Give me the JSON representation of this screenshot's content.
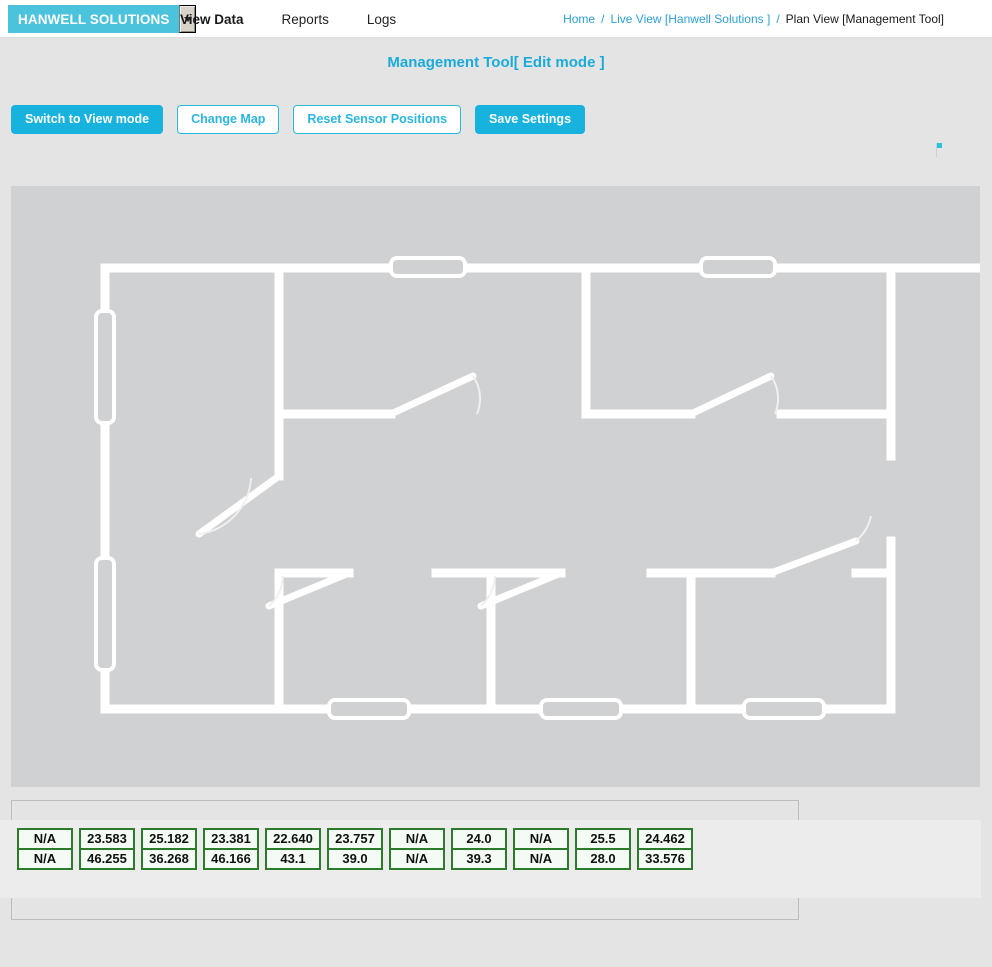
{
  "navbar": {
    "brand": "HANWELL SOLUTIONS",
    "brand_caret_icon": "chevron-down-icon",
    "links": [
      {
        "label": "View Data",
        "active": true
      },
      {
        "label": "Reports",
        "active": false
      },
      {
        "label": "Logs",
        "active": false
      }
    ]
  },
  "breadcrumb": {
    "home": "Home",
    "sep": "/",
    "live_view": "Live View [Hanwell Solutions ]",
    "current": "Plan View [Management Tool]"
  },
  "page": {
    "title": "Management Tool[ Edit mode ]",
    "title_color": "#1aabda"
  },
  "toolbar": {
    "switch_view_mode": "Switch to View mode",
    "change_map": "Change Map",
    "reset_sensor_positions": "Reset Sensor Positions",
    "save_settings": "Save Settings",
    "accent_color": "#17b2dd"
  },
  "map": {
    "background_color": "#d0d1d3",
    "wall_color": "#ffffff",
    "alt_text": "Building floor plan with walls, windows and door swing arcs"
  },
  "sensors": {
    "border_color": "#2c7a2c",
    "items": [
      {
        "temperature": "N/A",
        "humidity": "N/A"
      },
      {
        "temperature": "23.583",
        "humidity": "46.255"
      },
      {
        "temperature": "25.182",
        "humidity": "36.268"
      },
      {
        "temperature": "23.381",
        "humidity": "46.166"
      },
      {
        "temperature": "22.640",
        "humidity": "43.1"
      },
      {
        "temperature": "23.757",
        "humidity": "39.0"
      },
      {
        "temperature": "N/A",
        "humidity": "N/A"
      },
      {
        "temperature": "24.0",
        "humidity": "39.3"
      },
      {
        "temperature": "N/A",
        "humidity": "N/A"
      },
      {
        "temperature": "25.5",
        "humidity": "28.0"
      },
      {
        "temperature": "24.462",
        "humidity": "33.576"
      }
    ]
  }
}
